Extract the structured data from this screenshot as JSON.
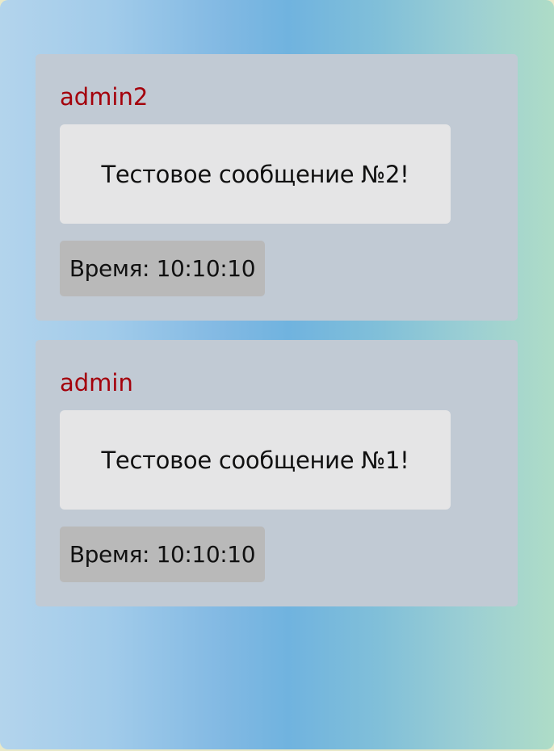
{
  "messages": [
    {
      "author": "admin2",
      "text": "Тестовое сообщение №2!",
      "time": "Время: 10:10:10"
    },
    {
      "author": "admin",
      "text": "Тестовое сообщение №1!",
      "time": "Время: 10:10:10"
    }
  ],
  "colors": {
    "author": "#a4000b",
    "card": "#c1cad4",
    "bubble": "#e5e5e6",
    "time_badge": "#b9b9b9"
  }
}
